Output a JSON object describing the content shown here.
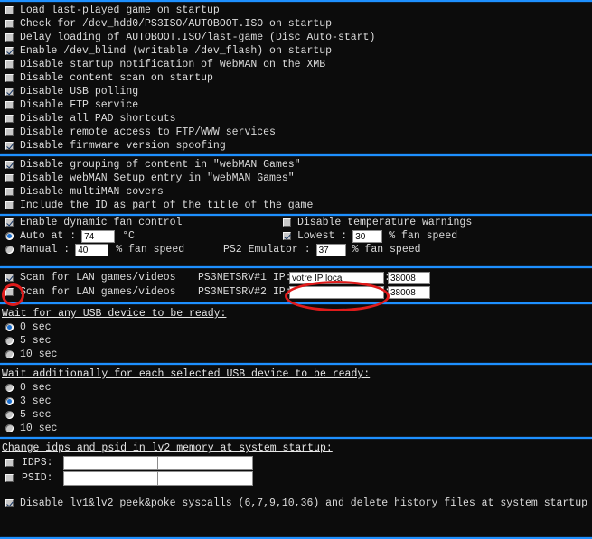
{
  "colors": {
    "background": "#0c0c0c",
    "separator": "#1e90ff",
    "text": "#dcdcdc",
    "annotation": "#e01b1b",
    "input_bg": "#ffffff"
  },
  "sections": {
    "startup": {
      "items": [
        {
          "label": "Load last-played game on startup",
          "checked": false
        },
        {
          "label": "Check for /dev_hdd0/PS3ISO/AUTOBOOT.ISO on startup",
          "checked": false
        },
        {
          "label": "Delay loading of AUTOBOOT.ISO/last-game (Disc Auto-start)",
          "checked": false
        },
        {
          "label": "Enable /dev_blind (writable /dev_flash) on startup",
          "checked": true
        },
        {
          "label": "Disable startup notification of WebMAN on the XMB",
          "checked": false
        },
        {
          "label": "Disable content scan on startup",
          "checked": false
        },
        {
          "label": "Disable USB polling",
          "checked": true
        },
        {
          "label": "Disable FTP service",
          "checked": false
        },
        {
          "label": "Disable all PAD shortcuts",
          "checked": false
        },
        {
          "label": "Disable remote access to FTP/WWW services",
          "checked": false
        },
        {
          "label": "Disable firmware version spoofing",
          "checked": true
        }
      ]
    },
    "content": {
      "items": [
        {
          "label": "Disable grouping of content in \"webMAN Games\"",
          "checked": true
        },
        {
          "label": "Disable webMAN Setup entry in \"webMAN Games\"",
          "checked": false
        },
        {
          "label": "Disable multiMAN covers",
          "checked": false
        },
        {
          "label": "Include the ID as part of the title of the game",
          "checked": false
        }
      ]
    },
    "fan": {
      "enable_label": "Enable dynamic fan control",
      "enable_checked": true,
      "auto_label": "Auto at :",
      "auto_selected": true,
      "auto_value": "74",
      "auto_unit": "°C",
      "manual_label": "Manual :",
      "manual_selected": false,
      "manual_value": "40",
      "manual_unit": "% fan speed",
      "warn_label": "Disable temperature warnings",
      "warn_checked": false,
      "lowest_label": "Lowest :",
      "lowest_checked": true,
      "lowest_value": "30",
      "lowest_unit": "% fan speed",
      "ps2_label": "PS2 Emulator :",
      "ps2_value": "37",
      "ps2_unit": "% fan speed"
    },
    "lan": {
      "rows": [
        {
          "label": "Scan for LAN games/videos",
          "checked": true,
          "server": "PS3NETSRV#1 IP:",
          "ip": "votre IP local",
          "colon": ":",
          "port": "38008"
        },
        {
          "label": "Scan for LAN games/videos",
          "checked": false,
          "server": "PS3NETSRV#2 IP:",
          "ip": "",
          "colon": ":",
          "port": "38008"
        }
      ]
    },
    "wait_any": {
      "header": "Wait for any USB device to be ready:",
      "options": [
        {
          "label": "0 sec",
          "selected": true
        },
        {
          "label": "5 sec",
          "selected": false
        },
        {
          "label": "10 sec",
          "selected": false
        }
      ]
    },
    "wait_each": {
      "header": "Wait additionally for each selected USB device to be ready:",
      "options": [
        {
          "label": "0 sec",
          "selected": false
        },
        {
          "label": "3 sec",
          "selected": true
        },
        {
          "label": "5 sec",
          "selected": false
        },
        {
          "label": "10 sec",
          "selected": false
        }
      ]
    },
    "idps": {
      "header": "Change idps and psid in lv2 memory at system startup:",
      "rows": [
        {
          "label": "IDPS:",
          "checked": false,
          "value1": "",
          "value2": ""
        },
        {
          "label": "PSID:",
          "checked": false,
          "value1": "",
          "value2": ""
        }
      ]
    },
    "syscalls": {
      "label": "Disable lv1&lv2 peek&poke syscalls (6,7,9,10,36) and delete history files at system startup",
      "checked": true
    }
  },
  "annotations": [
    {
      "name": "ip-field-highlight",
      "shape": "oval",
      "color": "#e01b1b"
    },
    {
      "name": "lan-checkbox-highlight",
      "shape": "oval",
      "color": "#e01b1b"
    }
  ]
}
